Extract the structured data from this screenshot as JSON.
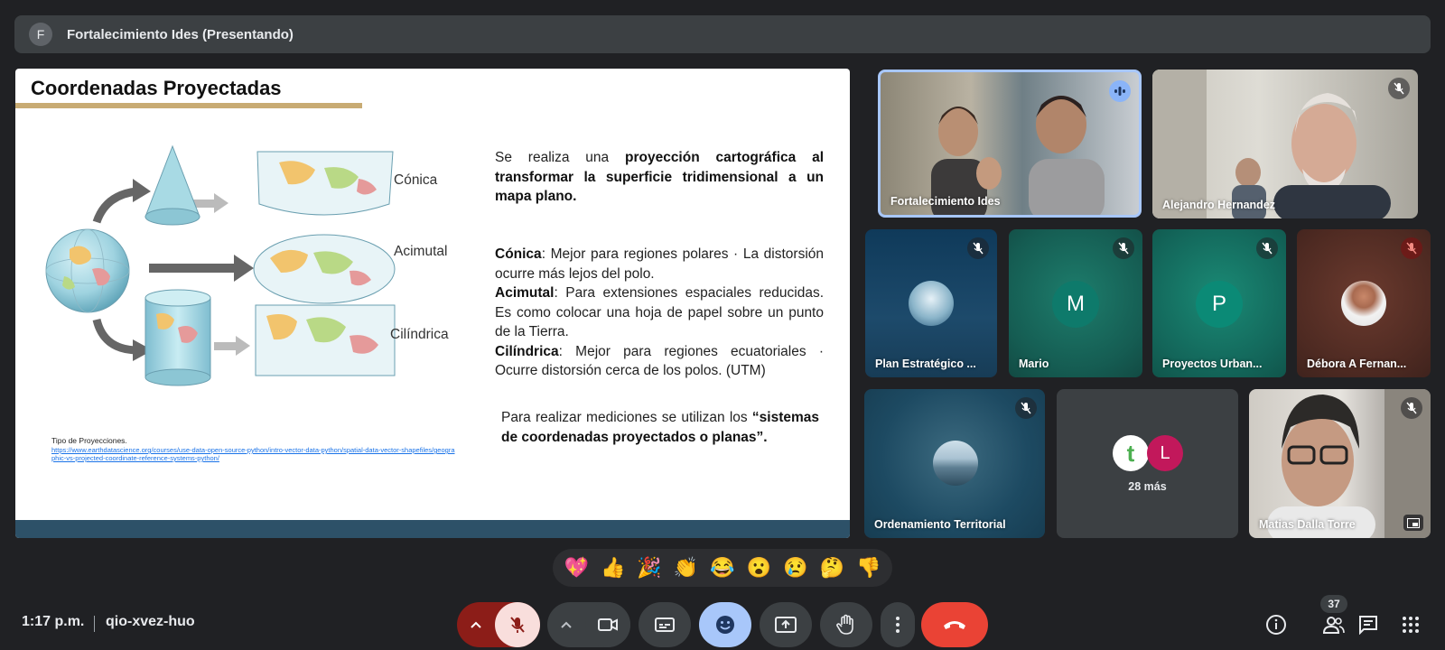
{
  "presenter_bar": {
    "avatar_letter": "F",
    "title": "Fortalecimiento Ides (Presentando)"
  },
  "slide": {
    "title": "Coordenadas Proyectadas",
    "labels": {
      "conica": "Cónica",
      "acimutal": "Acimutal",
      "cilindrica": "Cilíndrica"
    },
    "p1_a": "Se realiza una ",
    "p1_b": "proyección cartográfica al transformar la superficie tridimensional a un mapa plano.",
    "conica_term": "Cónica",
    "conica_text": ": Mejor para regiones polares · La distorsión ocurre más lejos del polo.",
    "acimutal_term": "Acimutal",
    "acimutal_text": ": Para extensiones espaciales reducidas. Es como colocar una hoja de papel sobre un punto de la Tierra.",
    "cilindrica_term": "Cilíndrica",
    "cilindrica_text": ": Mejor para regiones ecuatoriales · Ocurre distorsión cerca de los polos. (UTM)",
    "p3_a": "Para realizar mediciones se utilizan los ",
    "p3_b": "“sistemas de coordenadas proyectados o planas”.",
    "source_caption": "Tipo de Proyecciones.",
    "source_link": "https://www.earthdatascience.org/courses/use-data-open-source-python/intro-vector-data-python/spatial-data-vector-shapefiles/geographic-vs-projected-coordinate-reference-systems-python/"
  },
  "participants": [
    {
      "name": "Fortalecimiento Ides",
      "status": "speaking"
    },
    {
      "name": "Alejandro Hernandez",
      "status": "muted"
    },
    {
      "name": "Plan Estratégico ...",
      "status": "muted"
    },
    {
      "name": "Mario",
      "status": "muted",
      "avatar_letter": "M",
      "color": "#0e7a6b"
    },
    {
      "name": "Proyectos Urban...",
      "status": "muted",
      "avatar_letter": "P",
      "color": "#0b8a76"
    },
    {
      "name": "Débora A Fernan...",
      "status": "muted"
    },
    {
      "name": "Ordenamiento Territorial",
      "status": "muted"
    },
    {
      "name": "28 más",
      "avatar_letter": "L",
      "status": "overflow"
    },
    {
      "name": "Matias Dalla Torre",
      "status": "muted"
    }
  ],
  "reactions": [
    "💖",
    "👍",
    "🎉",
    "👏",
    "😂",
    "😮",
    "😢",
    "🤔",
    "👎"
  ],
  "bottom_bar": {
    "time": "1:17 p.m.",
    "meeting_code": "qio-xvez-huo",
    "people_count": "37"
  },
  "colors": {
    "end_call": "#ea4335",
    "mic_muted_bg": "#f9dedc",
    "mic_arrow_bg": "#8c1d18",
    "reaction_active": "#a8c7fa",
    "speaking_border": "#a8c7fa"
  }
}
